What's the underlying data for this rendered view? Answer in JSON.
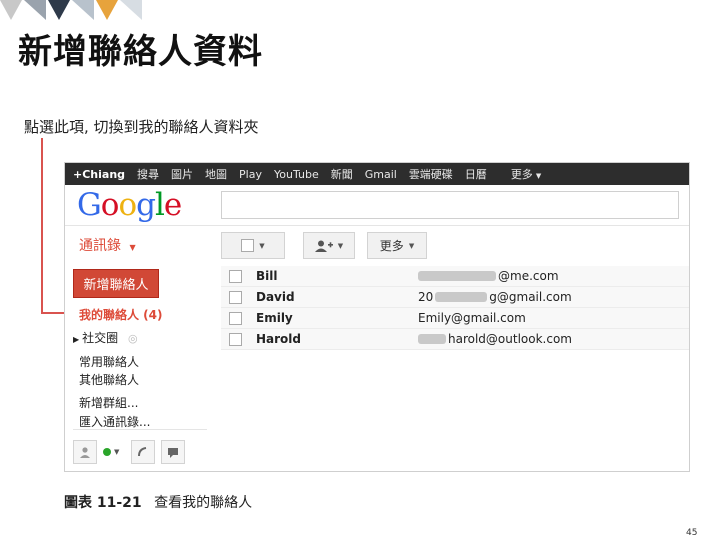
{
  "slide": {
    "title": "新增聯絡人資料",
    "instruction": "點選此項, 切換到我的聯絡人資料夾",
    "caption_figure": "圖表 11-21",
    "caption_text": "查看我的聯絡人",
    "page_number": "45"
  },
  "gbar": {
    "items": [
      "+Chiang",
      "搜尋",
      "圖片",
      "地圖",
      "Play",
      "YouTube",
      "新聞",
      "Gmail",
      "雲端硬碟",
      "日曆",
      "更多"
    ]
  },
  "logo": {
    "letters": [
      "G",
      "o",
      "o",
      "g",
      "l",
      "e"
    ],
    "colors": [
      "#3369e8",
      "#d50f25",
      "#eeb211",
      "#3369e8",
      "#009925",
      "#d50f25"
    ]
  },
  "contacts": {
    "label": "通訊錄",
    "toolbar_more": "更多",
    "new_contact": "新增聯絡人",
    "my_contacts": "我的聯絡人 (4)",
    "circles": "社交圈",
    "frequent": "常用聯絡人",
    "other": "其他聯絡人",
    "new_group": "新增群組...",
    "import": "匯入通訊錄...",
    "rows": [
      {
        "name": "Bill",
        "email": "@me.com"
      },
      {
        "name": "David",
        "email_prefix": "20",
        "email": "g@gmail.com"
      },
      {
        "name": "Emily",
        "email": "Emily@gmail.com"
      },
      {
        "name": "Harold",
        "email": "harold@outlook.com"
      }
    ]
  },
  "colors": {
    "accent_red": "#dd4b39",
    "button_red": "#d14836",
    "gbar_bg": "#2d2d2d",
    "callout": "#d9534f"
  }
}
